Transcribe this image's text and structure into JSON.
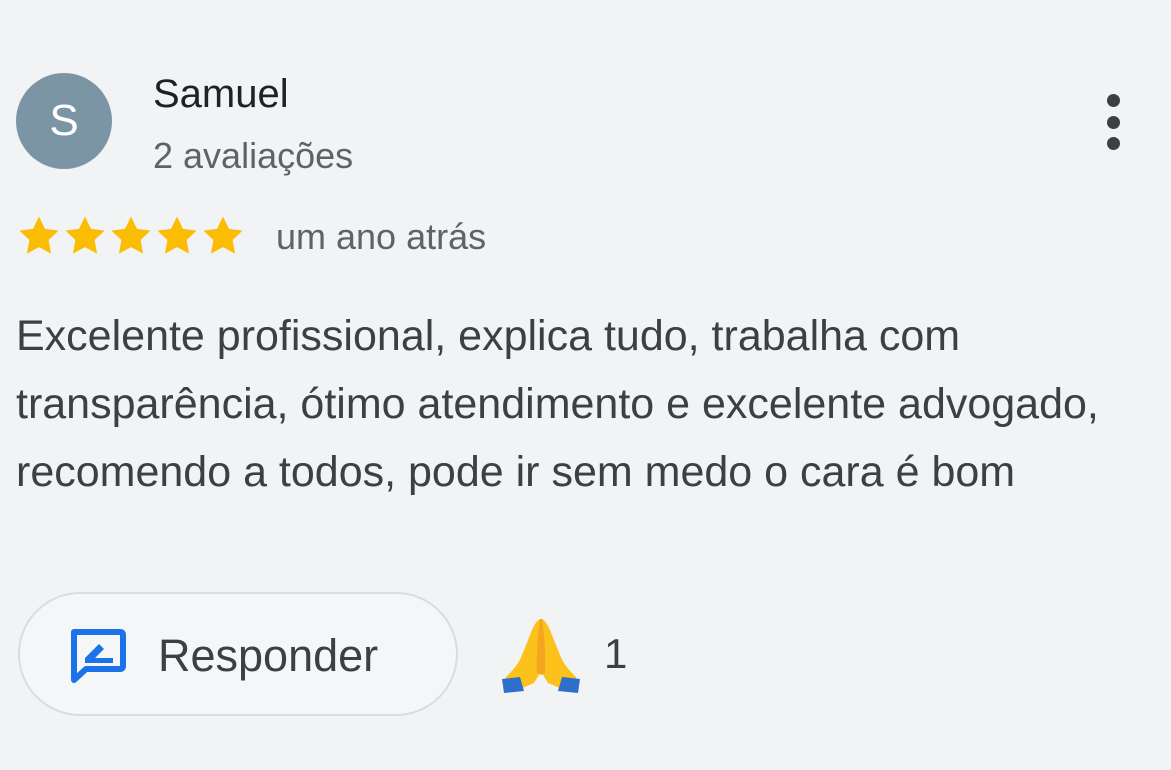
{
  "author": {
    "initial": "S",
    "name": "Samuel",
    "review_count": "2 avaliações",
    "avatar_color": "#7b95a5"
  },
  "rating": {
    "stars": 5,
    "max_stars": 5,
    "star_color": "#fbbc04",
    "time": "um ano atrás"
  },
  "review": {
    "text": "Excelente profissional, explica tudo, trabalha com transparência, ótimo atendimento e excelente advogado, recomendo a todos, pode ir sem medo o cara é bom"
  },
  "actions": {
    "reply_label": "Responder",
    "reply_icon": "reply-icon",
    "reaction_icon": "folded-hands-icon",
    "reaction_count": "1",
    "more_icon": "more-vertical-icon"
  },
  "colors": {
    "accent_blue": "#1a73e8",
    "background": "#f2f3f5"
  }
}
